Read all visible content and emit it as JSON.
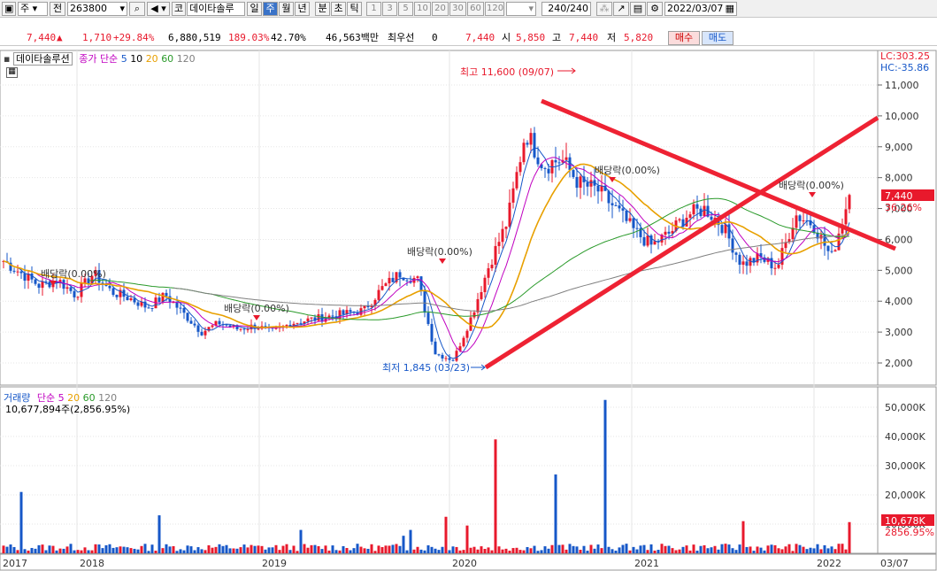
{
  "toolbar": {
    "market_type": "주",
    "market_sub": "전",
    "code": "263800",
    "market_label": "코",
    "stock_name": "데이타솔루",
    "periods": [
      "일",
      "주",
      "월",
      "년",
      "분",
      "초",
      "틱"
    ],
    "active_period": "주",
    "intervals": [
      "1",
      "3",
      "5",
      "10",
      "20",
      "30",
      "60",
      "120"
    ],
    "count": "240",
    "count_total": "/240",
    "date": "2022/03/07"
  },
  "quote": {
    "price": "7,440",
    "change": "1,710",
    "change_pct": "+29.84%",
    "volume": "6,880,519",
    "volume_ratio": "189.03%",
    "turnover": "42.70%",
    "amount": "46,563백만",
    "priority_label": "최우선",
    "priority_value": "0",
    "price2": "7,440",
    "open_label": "시",
    "open": "5,850",
    "high_label": "고",
    "high": "7,440",
    "low_label": "저",
    "low": "5,820",
    "buy_label": "매수",
    "sell_label": "매도"
  },
  "price_panel": {
    "stock_label": "데이타솔루션",
    "ma_label": "종가 단순",
    "ma_periods": [
      "5",
      "10",
      "20",
      "60",
      "120"
    ],
    "lc": "LC:303.25",
    "hc": "HC:-35.86",
    "price_tag": "7,440",
    "pct_tag": "36.26%",
    "y_ticks": [
      "11,000",
      "10,000",
      "9,000",
      "8,000",
      "7,000",
      "6,000",
      "5,000",
      "4,000",
      "3,000",
      "2,000"
    ],
    "high_annotation": "최고 11,600 (09/07)",
    "low_annotation": "최저 1,845 (03/23)",
    "dividend_labels": [
      "배당락(0.00%)",
      "배당락(0.00%)",
      "배당락(0.00%)",
      "배당락(0.00%)",
      "배당락(0.00%)"
    ]
  },
  "volume_panel": {
    "label": "거래량",
    "ma_label": "단순",
    "ma_periods": [
      "5",
      "20",
      "60",
      "120"
    ],
    "value_text": "10,677,894주(2,856.95%)",
    "y_ticks": [
      "50,000K",
      "40,000K",
      "30,000K",
      "20,000K",
      "10,000K"
    ],
    "vol_tag": "10,678K",
    "vol_pct_tag": "2856.95%"
  },
  "x_axis": {
    "labels": [
      "2017",
      "2018",
      "2019",
      "2020",
      "2021",
      "2022",
      "03/07"
    ]
  },
  "chart_data": {
    "type": "line",
    "ylim": [
      1500,
      12000
    ],
    "series": [
      {
        "name": "종가",
        "values": [
          5300,
          4900,
          4500,
          4700,
          4200,
          4900,
          4300,
          4100,
          3800,
          4200,
          3600,
          3000,
          3300,
          3100,
          3200,
          3000,
          3300,
          3400,
          3500,
          3600,
          3700,
          4400,
          4900,
          4700,
          2300,
          2100,
          3500,
          5200,
          6600,
          9500,
          8400,
          8600,
          7800,
          7600,
          7000,
          6300,
          5800,
          6200,
          6800,
          7000,
          6400,
          5200,
          5400,
          5100,
          6800,
          6500,
          5400,
          7440
        ]
      }
    ],
    "high_point": {
      "label": "최고",
      "value": 11600,
      "date": "09/07"
    },
    "low_point": {
      "label": "최저",
      "value": 1845,
      "date": "03/23"
    }
  },
  "colors": {
    "up": "#e8192c",
    "down": "#1657c8",
    "ma5": "#1657c8",
    "ma10": "#c000c0",
    "ma20": "#e8a000",
    "ma60": "#2a9a2a",
    "ma120": "#808080",
    "trendline": "#ee2233"
  }
}
